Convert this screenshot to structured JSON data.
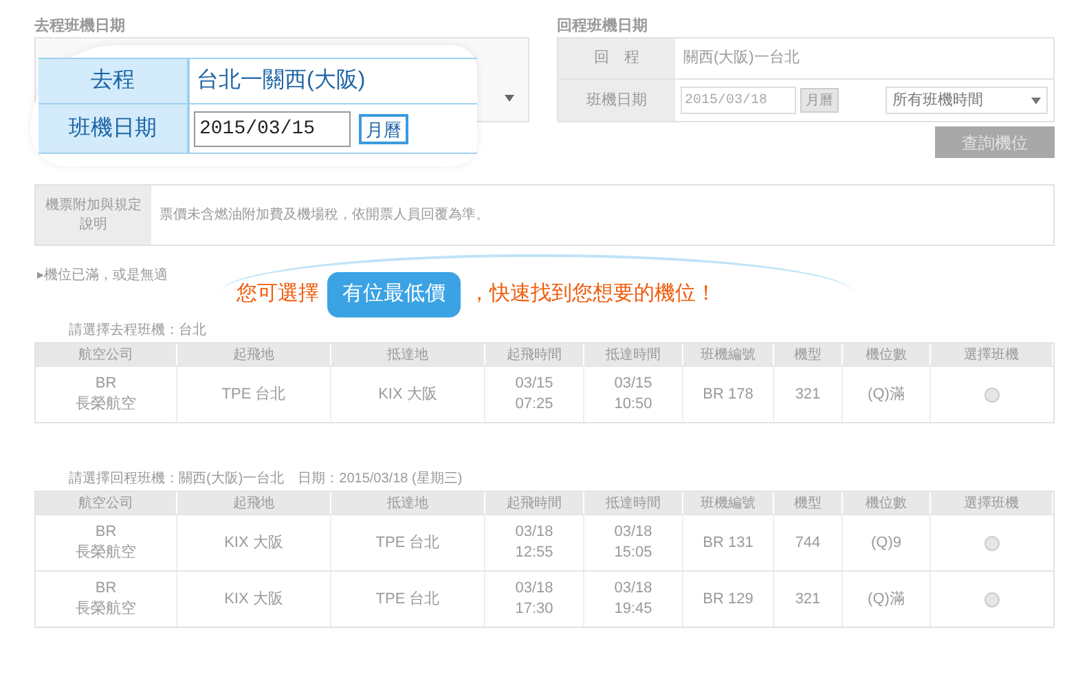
{
  "outbound_section": {
    "title": "去程班機日期"
  },
  "return_section": {
    "title": "回程班機日期",
    "route_label": "回　程",
    "route": "關西(大阪)一台北",
    "date_label": "班機日期",
    "date": "2015/03/18",
    "calendar_button": "月曆",
    "time_select": "所有班機時間"
  },
  "search_button": "查詢機位",
  "remarks": {
    "label": "機票附加與規定說明",
    "text": "票價未含燃油附加費及機場稅，依開票人員回覆為準。"
  },
  "notice": "▸機位已滿，或是無適",
  "outbound_flights": {
    "caption": "請選擇去程班機：台北",
    "columns": [
      "航空公司",
      "起飛地",
      "抵達地",
      "起飛時間",
      "抵達時間",
      "班機編號",
      "機型",
      "機位數",
      "選擇班機"
    ],
    "rows": [
      {
        "airline_code": "BR",
        "airline": "長榮航空",
        "from": "TPE 台北",
        "to": "KIX 大阪",
        "depart_date": "03/15",
        "depart_time": "07:25",
        "arrive_date": "03/15",
        "arrive_time": "10:50",
        "flight": "BR 178",
        "aircraft": "321",
        "seats": "(Q)滿",
        "selected": false
      }
    ]
  },
  "return_flights": {
    "caption": "請選擇回程班機：關西(大阪)一台北　日期：2015/03/18 (星期三)",
    "columns": [
      "航空公司",
      "起飛地",
      "抵達地",
      "起飛時間",
      "抵達時間",
      "班機編號",
      "機型",
      "機位數",
      "選擇班機"
    ],
    "rows": [
      {
        "airline_code": "BR",
        "airline": "長榮航空",
        "from": "KIX 大阪",
        "to": "TPE 台北",
        "depart_date": "03/18",
        "depart_time": "12:55",
        "arrive_date": "03/18",
        "arrive_time": "15:05",
        "flight": "BR 131",
        "aircraft": "744",
        "seats": "(Q)9",
        "selected": false
      },
      {
        "airline_code": "BR",
        "airline": "長榮航空",
        "from": "KIX 大阪",
        "to": "TPE 台北",
        "depart_date": "03/18",
        "depart_time": "17:30",
        "arrive_date": "03/18",
        "arrive_time": "19:45",
        "flight": "BR 129",
        "aircraft": "321",
        "seats": "(Q)滿",
        "selected": false
      }
    ]
  },
  "callouts": {
    "outbound": {
      "label": "去程",
      "route": "台北一關西(大阪)",
      "date_label": "班機日期",
      "date": "2015/03/15",
      "calendar_button": "月曆"
    },
    "tip": {
      "before": "您可選擇",
      "button": "有位最低價",
      "after": "，快速找到您想要的機位！"
    }
  }
}
